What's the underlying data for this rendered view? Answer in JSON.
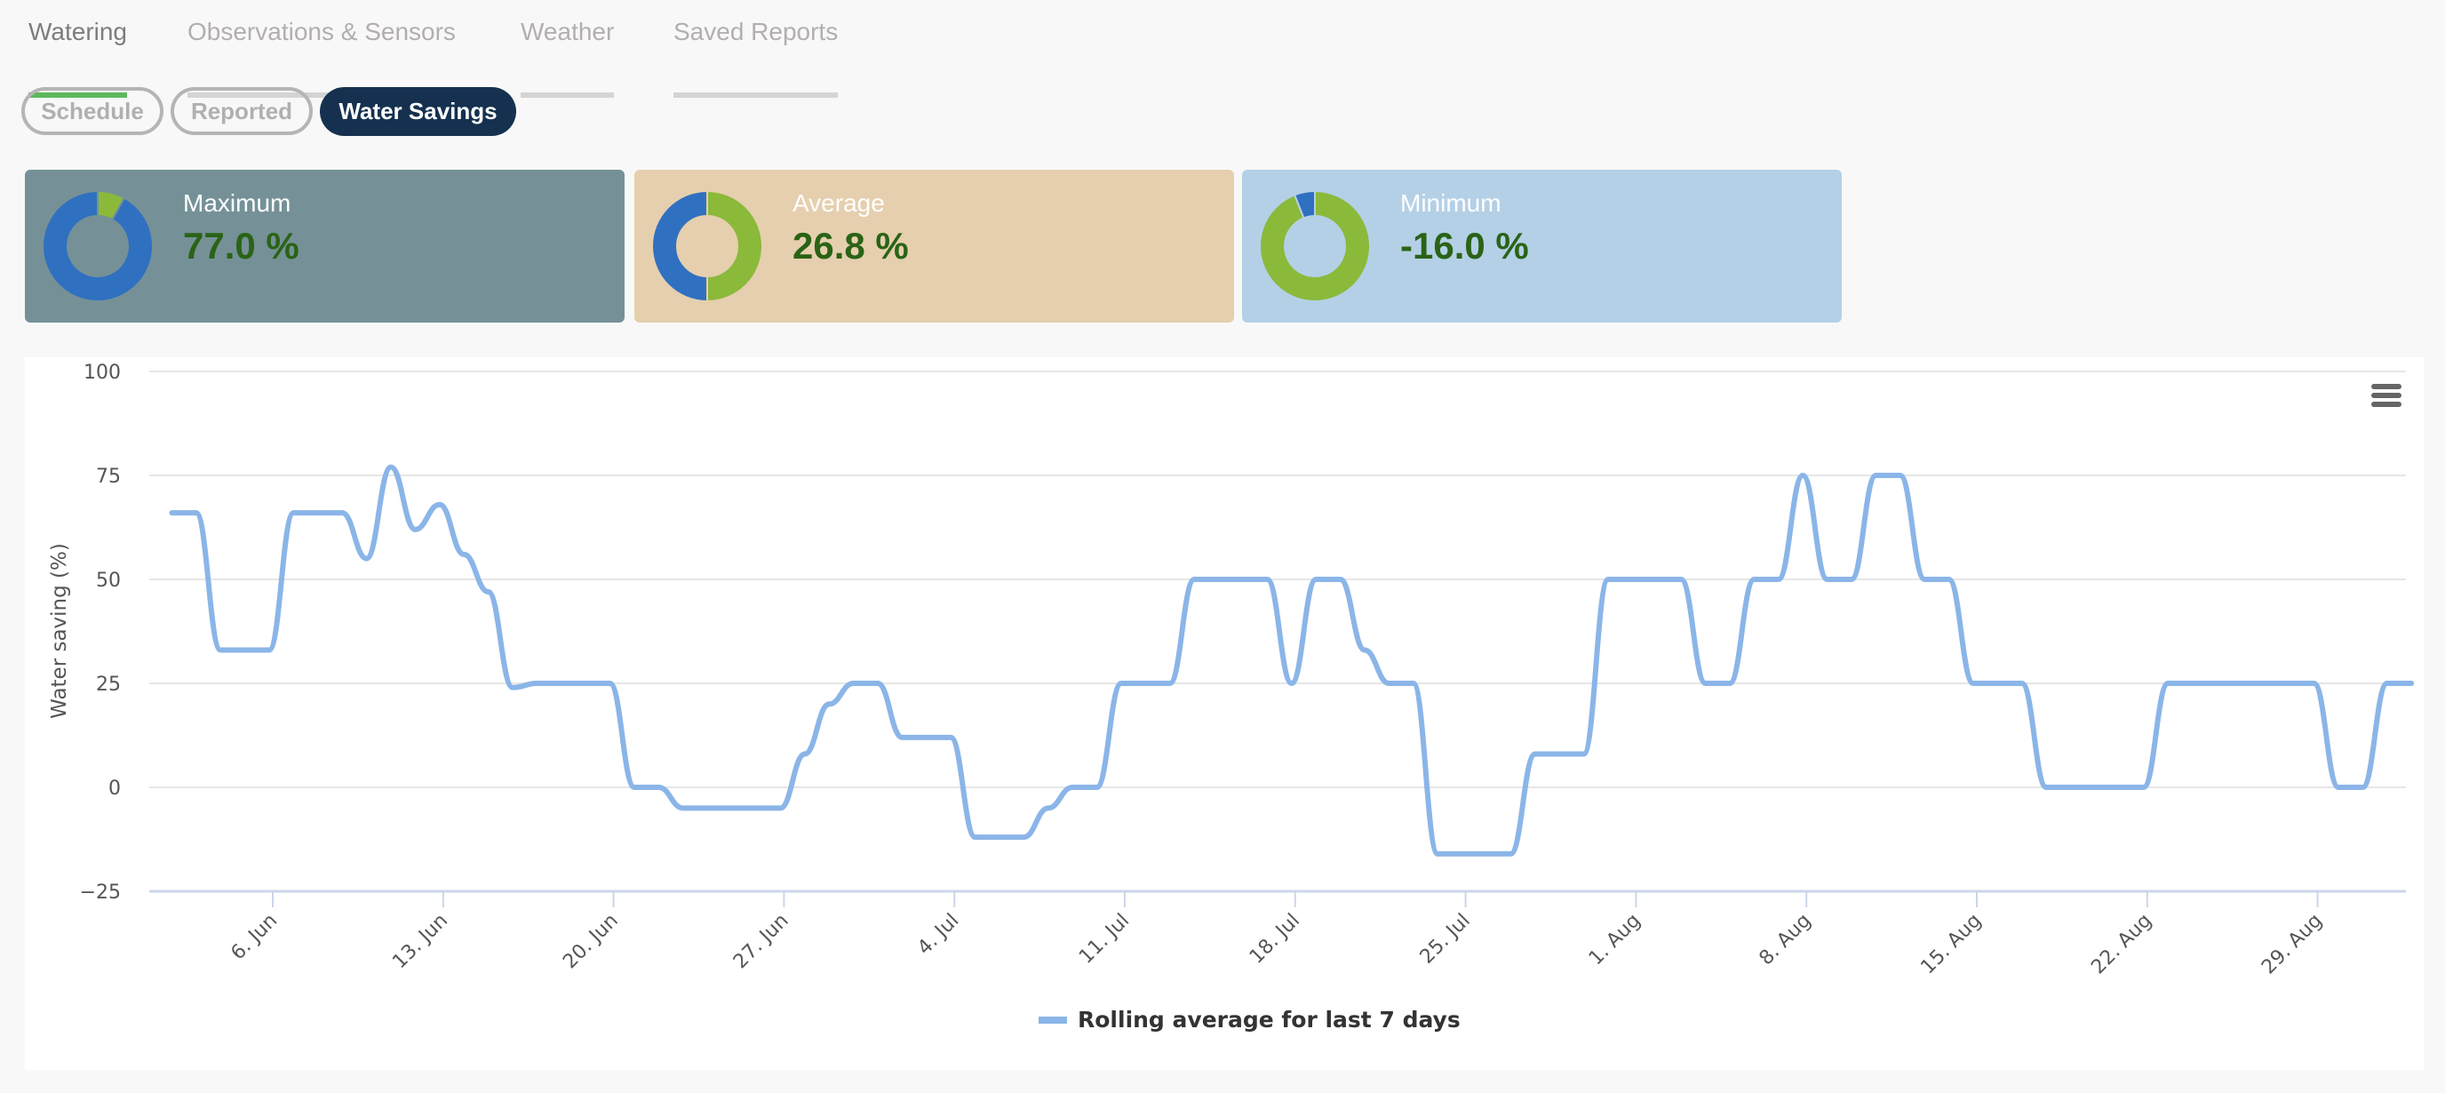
{
  "tabs": [
    {
      "label": "Watering",
      "active": true
    },
    {
      "label": "Observations & Sensors",
      "active": false
    },
    {
      "label": "Weather",
      "active": false
    },
    {
      "label": "Saved Reports",
      "active": false
    }
  ],
  "subtabs": [
    {
      "label": "Schedule",
      "active": false
    },
    {
      "label": "Reported",
      "active": false
    },
    {
      "label": "Water Savings",
      "active": true
    }
  ],
  "cards": [
    {
      "label": "Maximum",
      "value": "77.0 %",
      "bg": "#759197",
      "donut_green_fraction": 0.08,
      "donut_green_first": true
    },
    {
      "label": "Average",
      "value": "26.8 %",
      "bg": "#e5cfae",
      "donut_green_fraction": 0.5,
      "donut_green_first": true
    },
    {
      "label": "Minimum",
      "value": "-16.0 %",
      "bg": "#b4d0e6",
      "donut_green_fraction": 0.94,
      "donut_green_first": true
    }
  ],
  "colors": {
    "donut_blue": "#3070c0",
    "donut_green": "#8bb93a",
    "line": "#8bb5e8",
    "value_text": "#2a6316"
  },
  "chart_menu_icon": "hamburger-menu-icon",
  "chart_data": {
    "type": "line",
    "title": "",
    "xlabel": "",
    "ylabel": "Water saving (%)",
    "ylim": [
      -25,
      100
    ],
    "yticks": [
      -25,
      0,
      25,
      50,
      75,
      100
    ],
    "grid": true,
    "legend_position": "bottom-center",
    "xtick_labels": [
      "6. Jun",
      "13. Jun",
      "20. Jun",
      "27. Jun",
      "4. Jul",
      "11. Jul",
      "18. Jul",
      "25. Jul",
      "1. Aug",
      "8. Aug",
      "15. Aug",
      "22. Aug",
      "29. Aug"
    ],
    "x_start": "2 Jun",
    "x_end": "1 Sep",
    "series": [
      {
        "name": "Rolling average for last 7 days",
        "x_days": "daily from 2 Jun to 1 Sep",
        "values": [
          66,
          66,
          33,
          33,
          33,
          66,
          66,
          66,
          55,
          77,
          62,
          68,
          56,
          47,
          24,
          25,
          25,
          25,
          25,
          0,
          0,
          -5,
          -5,
          -5,
          -5,
          -5,
          8,
          20,
          25,
          25,
          12,
          12,
          12,
          -12,
          -12,
          -12,
          -5,
          0,
          0,
          25,
          25,
          25,
          50,
          50,
          50,
          50,
          25,
          50,
          50,
          33,
          25,
          25,
          -16,
          -16,
          -16,
          -16,
          8,
          8,
          8,
          50,
          50,
          50,
          50,
          25,
          25,
          50,
          50,
          75,
          50,
          50,
          75,
          75,
          50,
          50,
          25,
          25,
          25,
          0,
          0,
          0,
          0,
          0,
          25,
          25,
          25,
          25,
          25,
          25,
          25,
          0,
          0,
          25,
          25
        ]
      }
    ]
  }
}
